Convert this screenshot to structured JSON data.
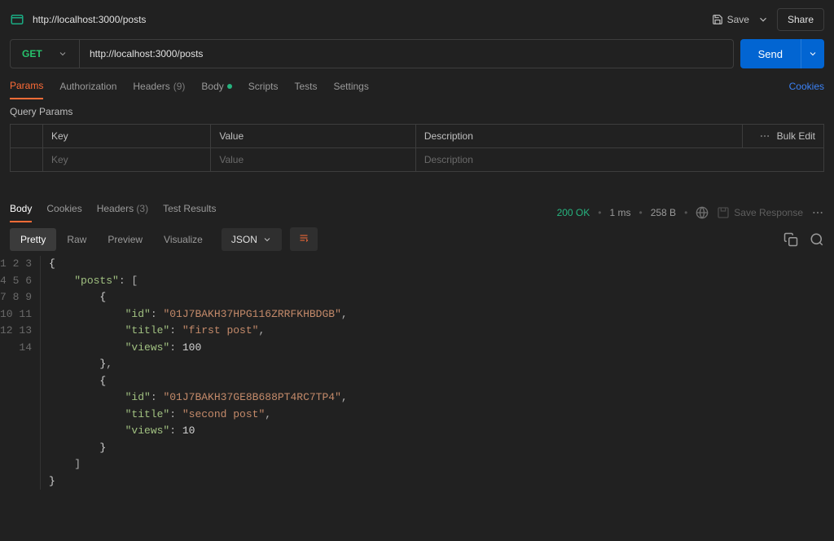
{
  "tab": {
    "title": "http://localhost:3000/posts"
  },
  "topbar": {
    "save_label": "Save",
    "share_label": "Share"
  },
  "request": {
    "method": "GET",
    "url": "http://localhost:3000/posts",
    "send_label": "Send"
  },
  "req_tabs": {
    "params": "Params",
    "authorization": "Authorization",
    "headers": "Headers",
    "headers_count": "(9)",
    "body": "Body",
    "scripts": "Scripts",
    "tests": "Tests",
    "settings": "Settings",
    "cookies": "Cookies"
  },
  "query_params": {
    "section_label": "Query Params",
    "key_header": "Key",
    "value_header": "Value",
    "desc_header": "Description",
    "bulk_edit": "Bulk Edit",
    "key_placeholder": "Key",
    "value_placeholder": "Value",
    "desc_placeholder": "Description"
  },
  "response": {
    "tabs": {
      "body": "Body",
      "cookies": "Cookies",
      "headers": "Headers",
      "headers_count": "(3)",
      "test_results": "Test Results"
    },
    "status": "200 OK",
    "time": "1 ms",
    "size": "258 B",
    "save_response": "Save Response"
  },
  "view_toolbar": {
    "pretty": "Pretty",
    "raw": "Raw",
    "preview": "Preview",
    "visualize": "Visualize",
    "lang": "JSON"
  },
  "chart_data": {
    "type": "table",
    "title": "posts",
    "columns": [
      "id",
      "title",
      "views"
    ],
    "rows": [
      {
        "id": "01J7BAKH37HPG116ZRRFKHBDGB",
        "title": "first post",
        "views": 100
      },
      {
        "id": "01J7BAKH37GE8B688PT4RC7TP4",
        "title": "second post",
        "views": 10
      }
    ]
  },
  "code": {
    "line_count": 14,
    "post0_id": "\"01J7BAKH37HPG116ZRRFKHBDGB\"",
    "post0_title": "\"first post\"",
    "post0_views": "100",
    "post1_id": "\"01J7BAKH37GE8B688PT4RC7TP4\"",
    "post1_title": "\"second post\"",
    "post1_views": "10",
    "k_posts": "\"posts\"",
    "k_id": "\"id\"",
    "k_title": "\"title\"",
    "k_views": "\"views\""
  }
}
